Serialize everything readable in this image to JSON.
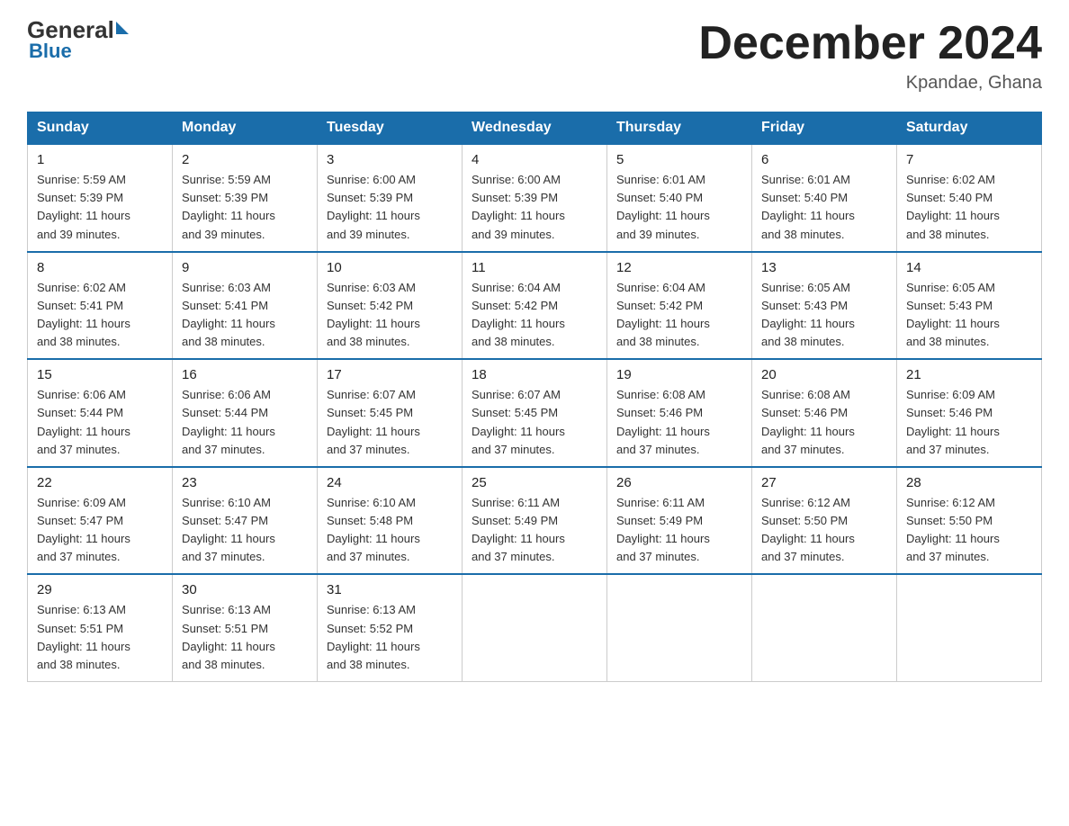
{
  "header": {
    "logo_text_black": "General",
    "logo_text_blue": "Blue",
    "month_title": "December 2024",
    "location": "Kpandae, Ghana"
  },
  "weekdays": [
    "Sunday",
    "Monday",
    "Tuesday",
    "Wednesday",
    "Thursday",
    "Friday",
    "Saturday"
  ],
  "weeks": [
    [
      {
        "day": "1",
        "sunrise": "5:59 AM",
        "sunset": "5:39 PM",
        "daylight": "11 hours and 39 minutes."
      },
      {
        "day": "2",
        "sunrise": "5:59 AM",
        "sunset": "5:39 PM",
        "daylight": "11 hours and 39 minutes."
      },
      {
        "day": "3",
        "sunrise": "6:00 AM",
        "sunset": "5:39 PM",
        "daylight": "11 hours and 39 minutes."
      },
      {
        "day": "4",
        "sunrise": "6:00 AM",
        "sunset": "5:39 PM",
        "daylight": "11 hours and 39 minutes."
      },
      {
        "day": "5",
        "sunrise": "6:01 AM",
        "sunset": "5:40 PM",
        "daylight": "11 hours and 39 minutes."
      },
      {
        "day": "6",
        "sunrise": "6:01 AM",
        "sunset": "5:40 PM",
        "daylight": "11 hours and 38 minutes."
      },
      {
        "day": "7",
        "sunrise": "6:02 AM",
        "sunset": "5:40 PM",
        "daylight": "11 hours and 38 minutes."
      }
    ],
    [
      {
        "day": "8",
        "sunrise": "6:02 AM",
        "sunset": "5:41 PM",
        "daylight": "11 hours and 38 minutes."
      },
      {
        "day": "9",
        "sunrise": "6:03 AM",
        "sunset": "5:41 PM",
        "daylight": "11 hours and 38 minutes."
      },
      {
        "day": "10",
        "sunrise": "6:03 AM",
        "sunset": "5:42 PM",
        "daylight": "11 hours and 38 minutes."
      },
      {
        "day": "11",
        "sunrise": "6:04 AM",
        "sunset": "5:42 PM",
        "daylight": "11 hours and 38 minutes."
      },
      {
        "day": "12",
        "sunrise": "6:04 AM",
        "sunset": "5:42 PM",
        "daylight": "11 hours and 38 minutes."
      },
      {
        "day": "13",
        "sunrise": "6:05 AM",
        "sunset": "5:43 PM",
        "daylight": "11 hours and 38 minutes."
      },
      {
        "day": "14",
        "sunrise": "6:05 AM",
        "sunset": "5:43 PM",
        "daylight": "11 hours and 38 minutes."
      }
    ],
    [
      {
        "day": "15",
        "sunrise": "6:06 AM",
        "sunset": "5:44 PM",
        "daylight": "11 hours and 37 minutes."
      },
      {
        "day": "16",
        "sunrise": "6:06 AM",
        "sunset": "5:44 PM",
        "daylight": "11 hours and 37 minutes."
      },
      {
        "day": "17",
        "sunrise": "6:07 AM",
        "sunset": "5:45 PM",
        "daylight": "11 hours and 37 minutes."
      },
      {
        "day": "18",
        "sunrise": "6:07 AM",
        "sunset": "5:45 PM",
        "daylight": "11 hours and 37 minutes."
      },
      {
        "day": "19",
        "sunrise": "6:08 AM",
        "sunset": "5:46 PM",
        "daylight": "11 hours and 37 minutes."
      },
      {
        "day": "20",
        "sunrise": "6:08 AM",
        "sunset": "5:46 PM",
        "daylight": "11 hours and 37 minutes."
      },
      {
        "day": "21",
        "sunrise": "6:09 AM",
        "sunset": "5:46 PM",
        "daylight": "11 hours and 37 minutes."
      }
    ],
    [
      {
        "day": "22",
        "sunrise": "6:09 AM",
        "sunset": "5:47 PM",
        "daylight": "11 hours and 37 minutes."
      },
      {
        "day": "23",
        "sunrise": "6:10 AM",
        "sunset": "5:47 PM",
        "daylight": "11 hours and 37 minutes."
      },
      {
        "day": "24",
        "sunrise": "6:10 AM",
        "sunset": "5:48 PM",
        "daylight": "11 hours and 37 minutes."
      },
      {
        "day": "25",
        "sunrise": "6:11 AM",
        "sunset": "5:49 PM",
        "daylight": "11 hours and 37 minutes."
      },
      {
        "day": "26",
        "sunrise": "6:11 AM",
        "sunset": "5:49 PM",
        "daylight": "11 hours and 37 minutes."
      },
      {
        "day": "27",
        "sunrise": "6:12 AM",
        "sunset": "5:50 PM",
        "daylight": "11 hours and 37 minutes."
      },
      {
        "day": "28",
        "sunrise": "6:12 AM",
        "sunset": "5:50 PM",
        "daylight": "11 hours and 37 minutes."
      }
    ],
    [
      {
        "day": "29",
        "sunrise": "6:13 AM",
        "sunset": "5:51 PM",
        "daylight": "11 hours and 38 minutes."
      },
      {
        "day": "30",
        "sunrise": "6:13 AM",
        "sunset": "5:51 PM",
        "daylight": "11 hours and 38 minutes."
      },
      {
        "day": "31",
        "sunrise": "6:13 AM",
        "sunset": "5:52 PM",
        "daylight": "11 hours and 38 minutes."
      },
      null,
      null,
      null,
      null
    ]
  ],
  "labels": {
    "sunrise": "Sunrise:",
    "sunset": "Sunset:",
    "daylight": "Daylight:"
  }
}
